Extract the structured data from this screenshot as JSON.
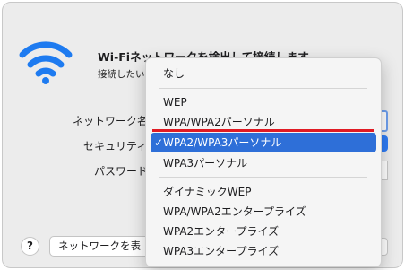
{
  "dialog": {
    "title": "Wi-Fiネットワークを検出して接続します。",
    "subtitle": "接続したい"
  },
  "form": {
    "network_name_label": "ネットワーク名",
    "security_label": "セキュリティ",
    "password_label": "パスワード"
  },
  "footer": {
    "help_label": "?",
    "show_networks_label": "ネットワークを表"
  },
  "security_menu": {
    "selected": "WPA2/WPA3パーソナル",
    "checkmark": "✓",
    "items": [
      "なし",
      "WEP",
      "WPA/WPA2パーソナル",
      "WPA2/WPA3パーソナル",
      "WPA3パーソナル",
      "ダイナミックWEP",
      "WPA/WPA2エンタープライズ",
      "WPA2エンタープライズ",
      "WPA3エンタープライズ"
    ]
  },
  "colors": {
    "wifi_icon": "#1e7bf0",
    "selection": "#2e6fd8",
    "highlight_underline": "#e01b24"
  },
  "icons": [
    "wifi-icon",
    "checkmark-icon"
  ]
}
